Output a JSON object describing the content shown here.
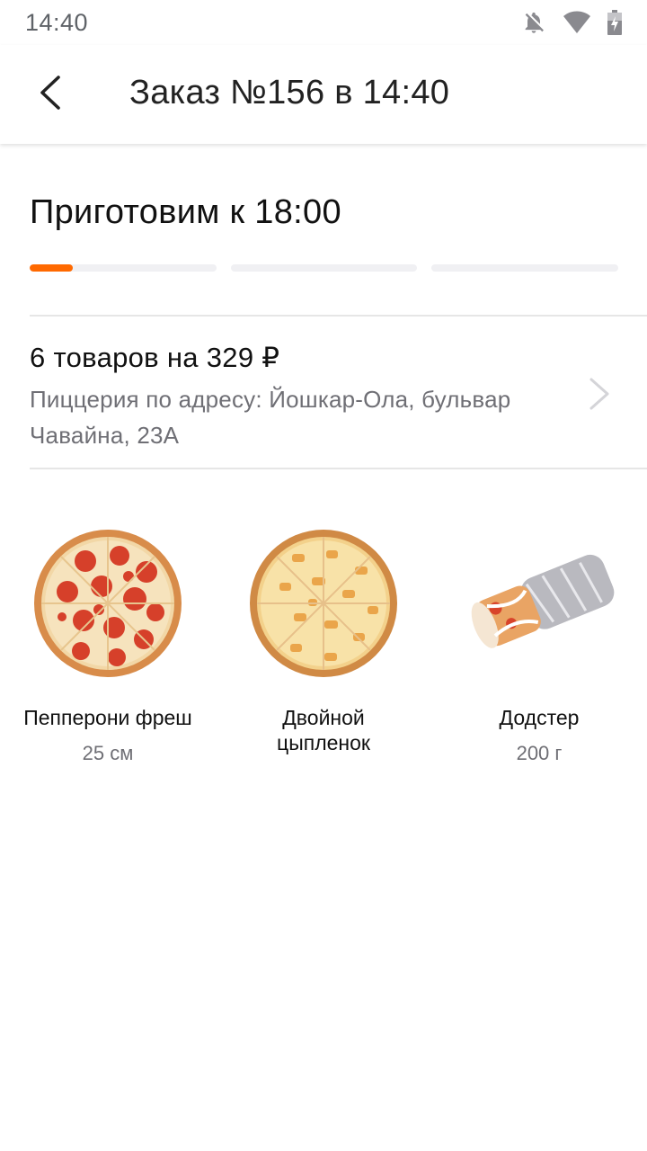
{
  "status_bar": {
    "time": "14:40",
    "icons": [
      "notifications-off-icon",
      "wifi-icon",
      "battery-charging-icon"
    ]
  },
  "header": {
    "title": "Заказ №156 в 14:40",
    "back_icon": "back-arrow-icon"
  },
  "order_status": {
    "title": "Приготовим к 18:00",
    "progress_steps": 3,
    "current_step_fill": 0.23,
    "accent_color": "#ff6900"
  },
  "summary": {
    "title": "6 товаров на 329 ₽",
    "address": "Пиццерия по адресу: Йошкар-Ола, бульвар Чавайна, 23А",
    "chevron_icon": "chevron-right-icon"
  },
  "products": [
    {
      "name": "Пепперони фреш",
      "size": "25 см",
      "image": "pepperoni-pizza-image"
    },
    {
      "name": "Двойной цыпленок",
      "size": "",
      "image": "chicken-pizza-image"
    },
    {
      "name": "Додстер",
      "size": "200 г",
      "image": "dodster-wrap-image"
    }
  ]
}
